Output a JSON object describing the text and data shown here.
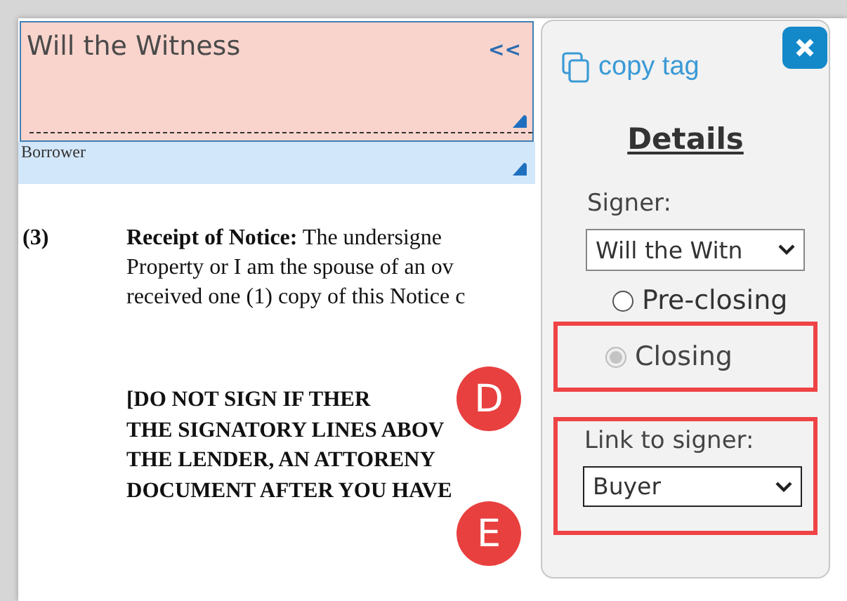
{
  "document": {
    "fields": [
      {
        "kind": "signer",
        "value": "Will the Witness",
        "toggle": "<<"
      },
      {
        "kind": "label",
        "value": "Borrower"
      }
    ],
    "section": {
      "number": "(3)",
      "lines": [
        "**Receipt of Notice:**  The undersigne",
        "Property or I am the spouse of an ov",
        "received one (1) copy of this Notice c"
      ]
    },
    "warning": [
      "[DO NOT SIGN IF THER",
      "THE SIGNATORY LINES ABOV",
      "THE LENDER, AN ATTORENY",
      "DOCUMENT AFTER YOU HAVE"
    ]
  },
  "callouts": [
    {
      "letter": "D"
    },
    {
      "letter": "E"
    }
  ],
  "popup": {
    "copy_link": "copy tag",
    "heading": "Details",
    "signer_label": "Signer:",
    "signer_value": "Will the Witn",
    "timing": [
      {
        "label": "Pre-closing",
        "selected": false,
        "disabled": false
      },
      {
        "label": "Closing",
        "selected": true,
        "disabled": true
      }
    ],
    "link_label": "Link to signer:",
    "link_value": "Buyer"
  }
}
